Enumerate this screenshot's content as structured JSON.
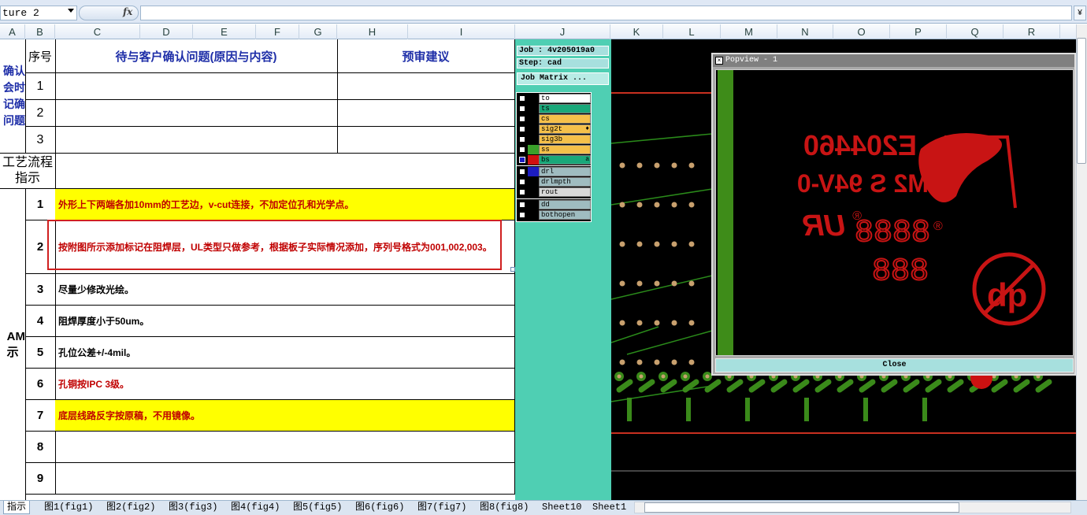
{
  "formula_bar": {
    "name_box": "ture 2",
    "fx": "fx",
    "expand": "¥"
  },
  "columns": [
    "A",
    "B",
    "C",
    "D",
    "E",
    "F",
    "G",
    "H",
    "I",
    "J",
    "K",
    "L",
    "M",
    "N",
    "O",
    "P",
    "Q",
    "R"
  ],
  "sheet": {
    "header": {
      "seq": "序号",
      "question": "待与客户确认问题(原因与内容)",
      "suggestion": "预审建议"
    },
    "left_label_1": "确认\n会时\n记确\n问题",
    "left_label_2": "工艺流程\n指示",
    "left_label_3": "AM\n示",
    "confirm_rows": [
      "1",
      "2",
      "3"
    ],
    "process_rows": [
      {
        "n": "1",
        "text": "外形上下两端各加10mm的工艺边，v-cut连接，不加定位孔和光学点。",
        "color": "red",
        "highlight": true
      },
      {
        "n": "2",
        "text": "按附图所示添加标记在阻焊层，UL类型只做参考，根据板子实际情况添加，序列号格式为001,002,003。",
        "color": "red",
        "highlight": false,
        "boxed": true
      },
      {
        "n": "3",
        "text": "尽量少修改光绘。",
        "color": "black",
        "highlight": false
      },
      {
        "n": "4",
        "text": "阻焊厚度小于50um。",
        "color": "black",
        "highlight": false
      },
      {
        "n": "5",
        "text": "孔位公差+/-4mil。",
        "color": "black",
        "highlight": false
      },
      {
        "n": "6",
        "text": "孔铜按IPC 3级。",
        "color": "red",
        "highlight": false
      },
      {
        "n": "7",
        "text": "底层线路反字按原稿，不用镜像。",
        "color": "red",
        "highlight": true
      },
      {
        "n": "8",
        "text": "",
        "color": "black",
        "highlight": false
      },
      {
        "n": "9",
        "text": "",
        "color": "black",
        "highlight": false
      }
    ]
  },
  "job_matrix": {
    "job": "Job : 4v205019a0",
    "step": "Step: cad",
    "button": "Job Matrix ...",
    "layers_group1": [
      {
        "name": "to",
        "color": "#ffffff",
        "sw": "#000000",
        "checked": false
      },
      {
        "name": "ts",
        "color": "#1aa87a",
        "sw": "#000000",
        "checked": false
      },
      {
        "name": "cs",
        "color": "#f5c04a",
        "sw": "#000000",
        "checked": false
      },
      {
        "name": "sig2t",
        "color": "#f5c04a",
        "sw": "#000000",
        "checked": false,
        "mark": "♦"
      },
      {
        "name": "sig3b",
        "color": "#f5c04a",
        "sw": "#000000",
        "checked": false
      },
      {
        "name": "ss",
        "color": "#f5c04a",
        "sw": "#3aa02a",
        "checked": false
      },
      {
        "name": "bs",
        "color": "#1aa87a",
        "sw": "#d01010",
        "checked": true,
        "mark": "a"
      }
    ],
    "layers_group2": [
      {
        "name": "drl",
        "color": "#9fbcc0",
        "sw": "#1c1cc0",
        "checked": false
      },
      {
        "name": "drlmpth",
        "color": "#9fbcc0",
        "sw": "#000000",
        "checked": false
      },
      {
        "name": "rout",
        "color": "#d8d8d8",
        "sw": "#000000",
        "checked": false
      }
    ],
    "layers_group3": [
      {
        "name": "dd",
        "color": "#9fbcc0",
        "sw": "#000000",
        "checked": false
      },
      {
        "name": "bothopen",
        "color": "#9fbcc0",
        "sw": "#000000",
        "checked": false
      }
    ]
  },
  "popup": {
    "title": "Popview - 1",
    "close": "Close",
    "marking_line1": "E204460",
    "marking_line2": "M2 S 94V-0",
    "ur_logo": "UR",
    "digits1": "8888",
    "digits2": "888",
    "registered": "®"
  },
  "tabs": [
    "指示",
    "图1(fig1)",
    "图2(fig2)",
    "图3(fig3)",
    "图4(fig4)",
    "图5(fig5)",
    "图6(fig6)",
    "图7(fig7)",
    "图8(fig8)",
    "Sheet10",
    "Sheet1"
  ],
  "colors": {
    "accent_red": "#c00000",
    "highlight": "#ffff00",
    "pcb_green": "#2a8a1a",
    "marking_red": "#c81414"
  }
}
